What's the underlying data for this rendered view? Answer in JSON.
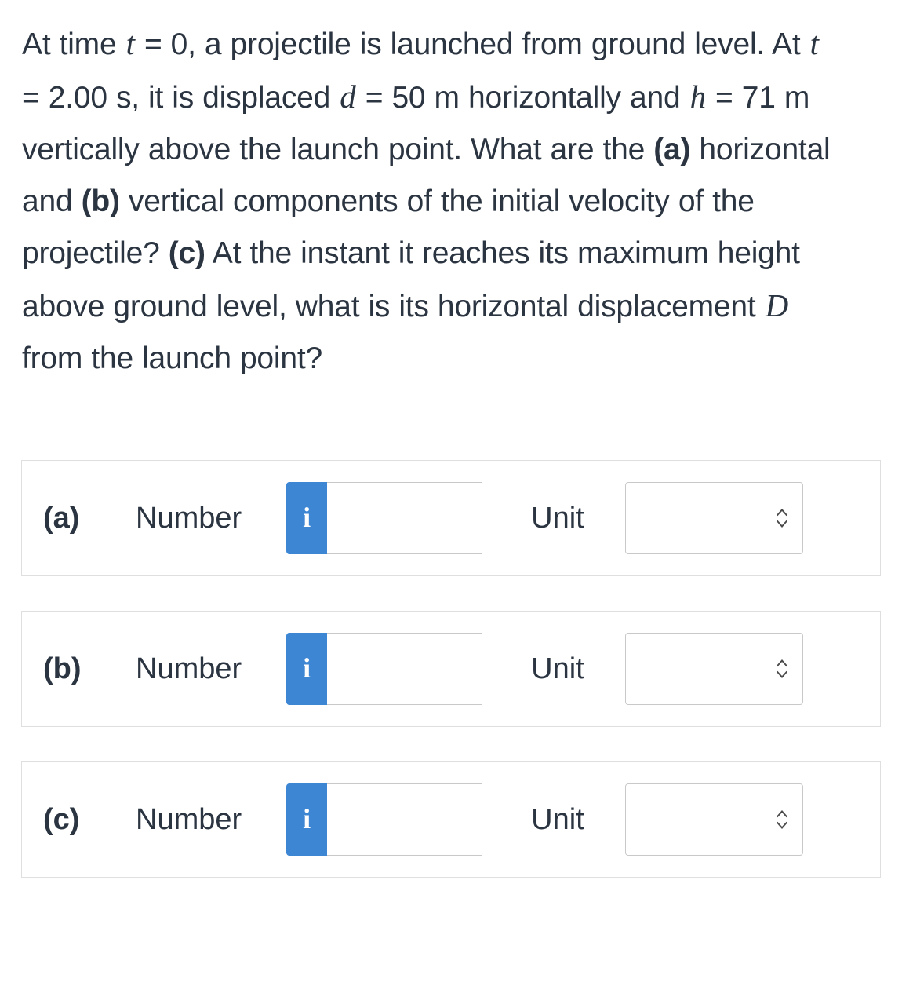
{
  "question": {
    "segments": [
      {
        "t": "At time ",
        "s": "plain"
      },
      {
        "t": "t",
        "s": "var"
      },
      {
        "t": " = 0, a projectile is launched from ground level. At ",
        "s": "plain"
      },
      {
        "t": "t",
        "s": "var"
      },
      {
        "t": " = 2.00 s, it is displaced ",
        "s": "plain"
      },
      {
        "t": "d",
        "s": "var"
      },
      {
        "t": " = 50 m horizontally and ",
        "s": "plain"
      },
      {
        "t": "h",
        "s": "var"
      },
      {
        "t": " = 71 m vertically above the launch point. What are the ",
        "s": "plain"
      },
      {
        "t": "(a)",
        "s": "bold"
      },
      {
        "t": " horizontal and ",
        "s": "plain"
      },
      {
        "t": "(b)",
        "s": "bold"
      },
      {
        "t": " vertical components of the initial velocity of the projectile? ",
        "s": "plain"
      },
      {
        "t": "(c)",
        "s": "bold"
      },
      {
        "t": " At the instant it reaches its maximum height above ground level, what is its horizontal displacement ",
        "s": "plain"
      },
      {
        "t": "D",
        "s": "var"
      },
      {
        "t": " from the launch point?",
        "s": "plain"
      }
    ],
    "plain_text": "At time t = 0, a projectile is launched from ground level. At t = 2.00 s, it is displaced d = 50 m horizontally and h = 71 m vertically above the launch point. What are the (a) horizontal and (b) vertical components of the initial velocity of the projectile? (c) At the instant it reaches its maximum height above ground level, what is its horizontal displacement D from the launch point?"
  },
  "answers": {
    "number_label": "Number",
    "unit_label": "Unit",
    "info_glyph": "i",
    "number_placeholder": "",
    "unit_selected": "",
    "unit_options": [
      ""
    ],
    "rows": [
      {
        "part": "(a)",
        "number_value": "",
        "unit_value": ""
      },
      {
        "part": "(b)",
        "number_value": "",
        "unit_value": ""
      },
      {
        "part": "(c)",
        "number_value": "",
        "unit_value": ""
      }
    ]
  },
  "colors": {
    "text": "#2b3441",
    "info_button": "#3d86d4",
    "box_border": "#dfdfdf",
    "field_border": "#c9c9c9",
    "background": "#ffffff"
  }
}
